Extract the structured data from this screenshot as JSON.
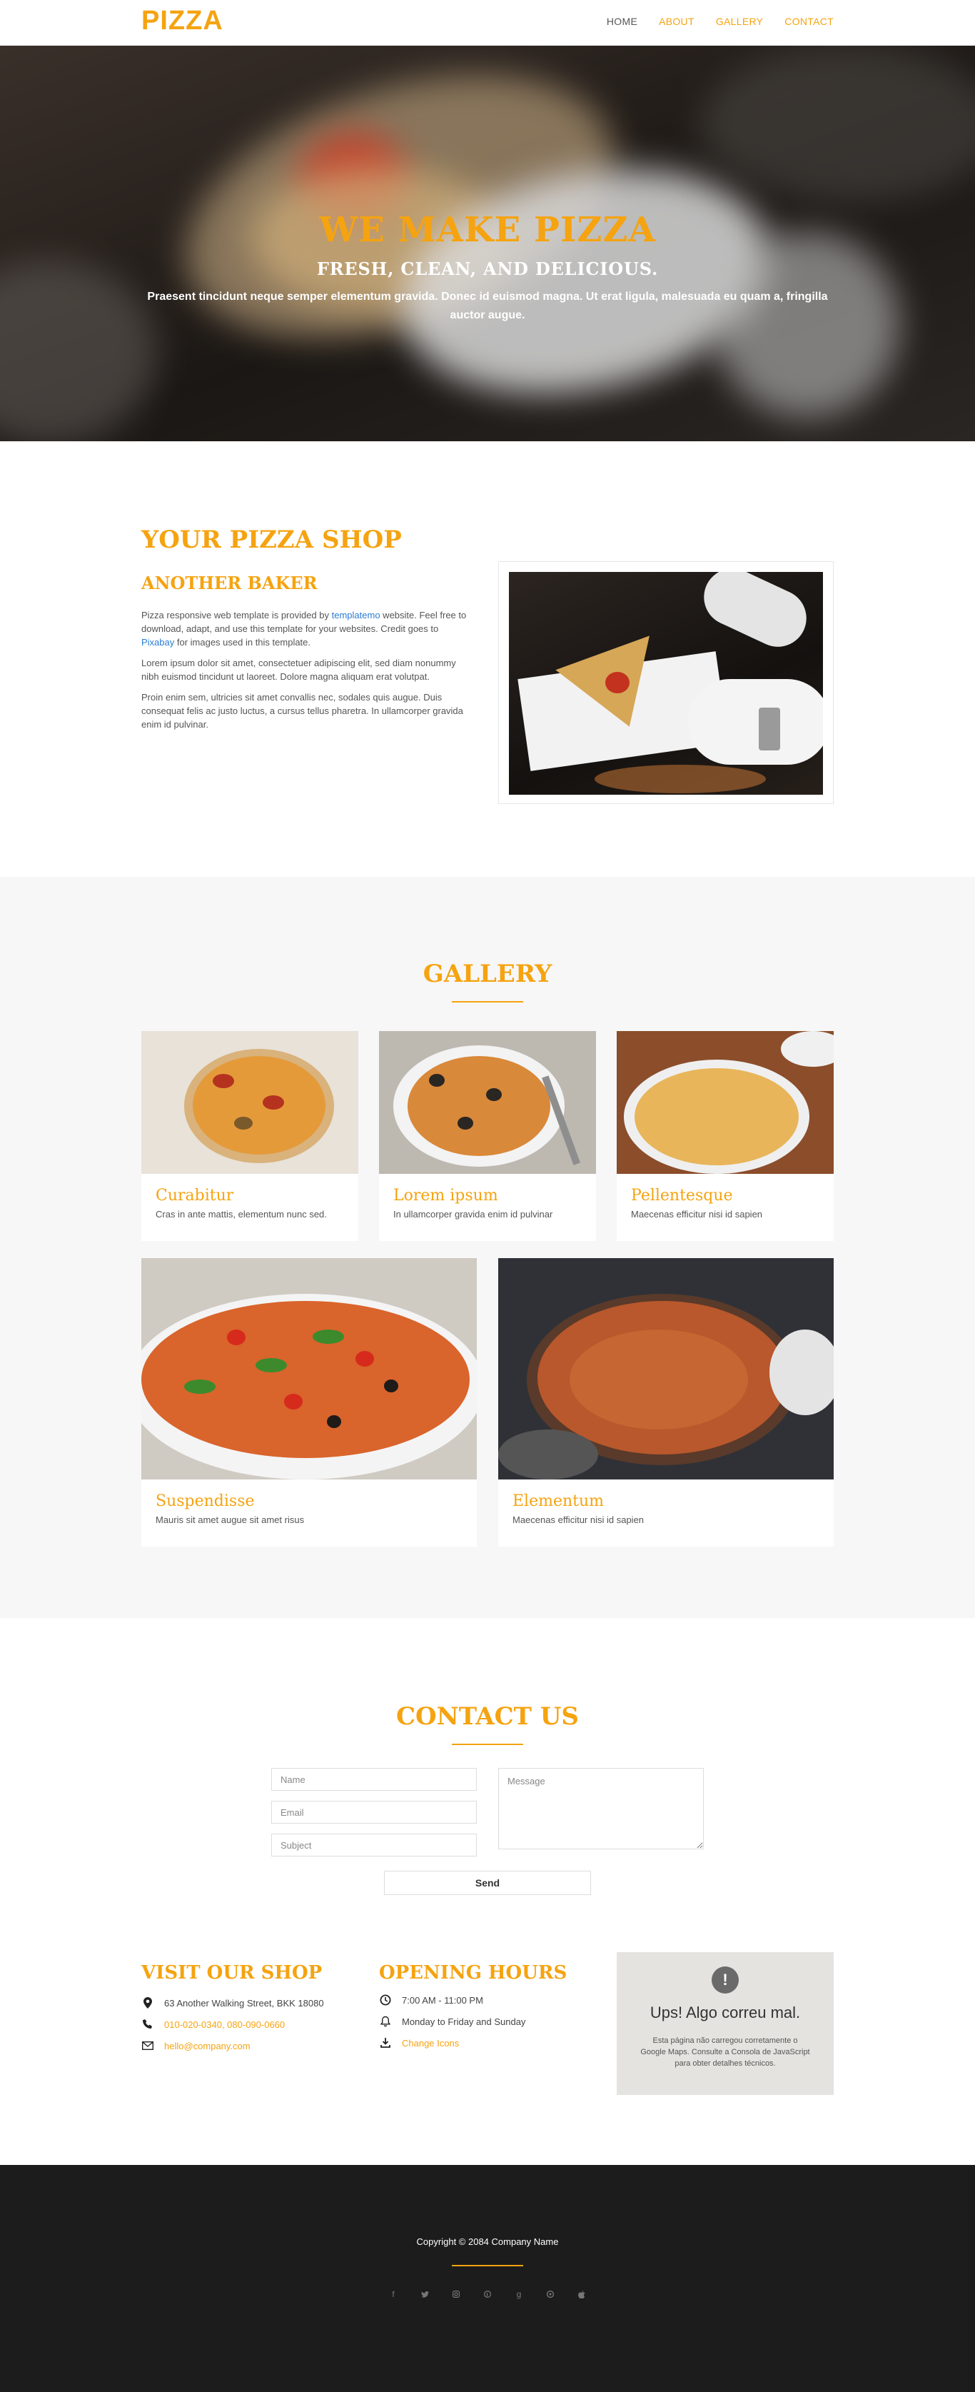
{
  "nav": {
    "brand": "PIZZA",
    "items": [
      {
        "label": "HOME",
        "active": true
      },
      {
        "label": "ABOUT",
        "active": false
      },
      {
        "label": "GALLERY",
        "active": false
      },
      {
        "label": "CONTACT",
        "active": false
      }
    ]
  },
  "hero": {
    "title": "WE MAKE PIZZA",
    "subtitle": "FRESH, CLEAN, AND DELICIOUS.",
    "description": "Praesent tincidunt neque semper elementum gravida. Donec id euismod magna. Ut erat ligula, malesuada eu quam a, fringilla auctor augue."
  },
  "about": {
    "title": "YOUR PIZZA SHOP",
    "subtitle": "ANOTHER BAKER",
    "p1_before": "Pizza responsive web template is provided by ",
    "p1_link1": "templatemo",
    "p1_middle": " website. Feel free to download, adapt, and use this template for your websites. Credit goes to ",
    "p1_link2": "Pixabay",
    "p1_after": " for images used in this template.",
    "p2": "Lorem ipsum dolor sit amet, consectetuer adipiscing elit, sed diam nonummy nibh euismod tincidunt ut laoreet. Dolore magna aliquam erat volutpat.",
    "p3": "Proin enim sem, ultricies sit amet convallis nec, sodales quis augue. Duis consequat felis ac justo luctus, a cursus tellus pharetra. In ullamcorper gravida enim id pulvinar."
  },
  "gallery": {
    "title": "GALLERY",
    "items": [
      {
        "caption": "Curabitur",
        "text": "Cras in ante mattis, elementum nunc sed."
      },
      {
        "caption": "Lorem ipsum",
        "text": "In ullamcorper gravida enim id pulvinar"
      },
      {
        "caption": "Pellentesque",
        "text": "Maecenas efficitur nisi id sapien"
      },
      {
        "caption": "Suspendisse",
        "text": "Mauris sit amet augue sit amet risus"
      },
      {
        "caption": "Elementum",
        "text": "Maecenas efficitur nisi id sapien"
      }
    ]
  },
  "contact": {
    "title": "CONTACT US",
    "name_placeholder": "Name",
    "email_placeholder": "Email",
    "subject_placeholder": "Subject",
    "message_placeholder": "Message",
    "send_label": "Send"
  },
  "shop": {
    "title": "VISIT OUR SHOP",
    "address": "63 Another Walking Street, BKK 18080",
    "phones": "010-020-0340, 080-090-0660",
    "email": "hello@company.com"
  },
  "hours": {
    "title": "OPENING HOURS",
    "time": "7:00 AM - 11:00 PM",
    "days": "Monday to Friday and Sunday",
    "link": "Change Icons"
  },
  "map": {
    "icon": "!",
    "title": "Ups! Algo correu mal.",
    "text": "Esta página não carregou corretamente o Google Maps. Consulte a Consola de JavaScript para obter detalhes técnicos."
  },
  "footer": {
    "copyright": "Copyright © 2084 Company Name",
    "social": [
      "facebook-icon",
      "twitter-icon",
      "instagram-icon",
      "pinterest-icon",
      "google-plus-icon",
      "github-icon",
      "apple-icon"
    ]
  },
  "colors": {
    "accent": "#f5a310",
    "footer_bg": "#1c1c1c",
    "gallery_bg": "#f7f7f7"
  }
}
